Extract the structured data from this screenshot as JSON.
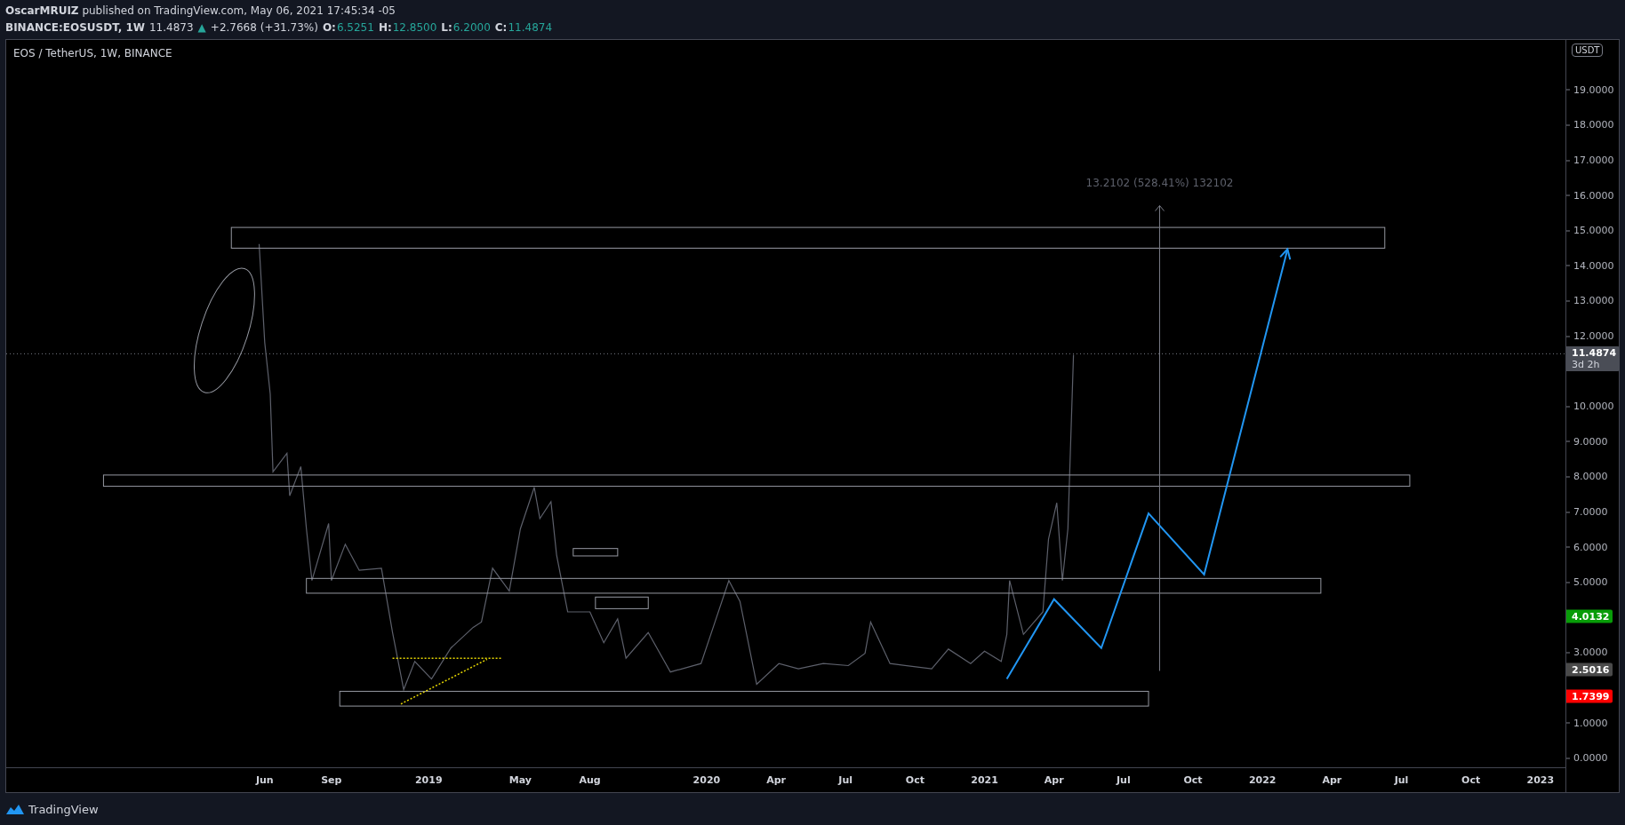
{
  "header": {
    "byline": "**OscarMRUIZ** published on TradingView.com, May 06, 2021 17:45:34 -05",
    "symbol": "BINANCE:EOSUSDT, 1W",
    "last": "11.4873",
    "change_arrow": "▲",
    "change": "+2.7668 (+31.73%)",
    "ohlc": [
      {
        "label": "O:",
        "value": "6.5251"
      },
      {
        "label": "H:",
        "value": "12.8500"
      },
      {
        "label": "L:",
        "value": "6.2000"
      },
      {
        "label": "C:",
        "value": "11.4874"
      }
    ]
  },
  "currency": "USDT",
  "chart_data": {
    "type": "line",
    "title": "EOS / TetherUS, 1W, BINANCE",
    "x": [
      2018.39,
      2018.41,
      2018.43,
      2018.44,
      2018.49,
      2018.5,
      2018.54,
      2018.56,
      2018.58,
      2018.64,
      2018.65,
      2018.7,
      2018.75,
      2018.83,
      2018.87,
      2018.91,
      2018.95,
      2019.01,
      2019.08,
      2019.16,
      2019.19,
      2019.23,
      2019.29,
      2019.33,
      2019.38,
      2019.4,
      2019.44,
      2019.46,
      2019.5,
      2019.58,
      2019.63,
      2019.68,
      2019.71,
      2019.79,
      2019.87,
      2019.98,
      2020.03,
      2020.08,
      2020.12,
      2020.18,
      2020.26,
      2020.33,
      2020.42,
      2020.51,
      2020.57,
      2020.59,
      2020.66,
      2020.81,
      2020.87,
      2020.95,
      2021.0,
      2021.06,
      2021.08,
      2021.09,
      2021.14,
      2021.21,
      2021.23,
      2021.26,
      2021.28,
      2021.3,
      2021.32
    ],
    "series": [
      {
        "color": "#5d606b",
        "values": [
          14.61,
          11.81,
          10.34,
          8.13,
          8.66,
          7.45,
          8.28,
          6.51,
          5.04,
          6.66,
          5.04,
          6.07,
          5.33,
          5.39,
          3.56,
          1.94,
          2.74,
          2.24,
          3.12,
          3.71,
          3.86,
          5.39,
          4.74,
          6.51,
          7.69,
          6.8,
          7.28,
          5.77,
          4.15,
          4.15,
          3.27,
          3.95,
          2.83,
          3.56,
          2.44,
          2.68,
          3.86,
          5.04,
          4.45,
          2.09,
          2.68,
          2.53,
          2.68,
          2.62,
          2.97,
          3.86,
          2.68,
          2.53,
          3.09,
          2.68,
          3.03,
          2.74,
          3.51,
          5.04,
          3.51,
          4.15,
          6.22,
          7.25,
          5.04,
          6.51,
          11.46
        ]
      }
    ],
    "xlim": [
      2017.48,
      2023.09
    ],
    "ylim": [
      -0.27,
      20.41
    ],
    "xticks": [
      {
        "value": 2018.41,
        "label": "Jun"
      },
      {
        "value": 2018.65,
        "label": "Sep"
      },
      {
        "value": 2019,
        "label": "2019"
      },
      {
        "value": 2019.33,
        "label": "May"
      },
      {
        "value": 2019.58,
        "label": "Aug"
      },
      {
        "value": 2020,
        "label": "2020"
      },
      {
        "value": 2020.25,
        "label": "Apr"
      },
      {
        "value": 2020.5,
        "label": "Jul"
      },
      {
        "value": 2020.75,
        "label": "Oct"
      },
      {
        "value": 2021,
        "label": "2021"
      },
      {
        "value": 2021.25,
        "label": "Apr"
      },
      {
        "value": 2021.5,
        "label": "Jul"
      },
      {
        "value": 2021.75,
        "label": "Oct"
      },
      {
        "value": 2022,
        "label": "2022"
      },
      {
        "value": 2022.25,
        "label": "Apr"
      },
      {
        "value": 2022.5,
        "label": "Jul"
      },
      {
        "value": 2022.75,
        "label": "Oct"
      },
      {
        "value": 2023,
        "label": "2023"
      }
    ],
    "yticks": [
      {
        "value": 0,
        "label": "0.0000"
      },
      {
        "value": 1,
        "label": "1.0000"
      },
      {
        "value": 3,
        "label": "3.0000"
      },
      {
        "value": 5,
        "label": "5.0000"
      },
      {
        "value": 6,
        "label": "6.0000"
      },
      {
        "value": 7,
        "label": "7.0000"
      },
      {
        "value": 8,
        "label": "8.0000"
      },
      {
        "value": 9,
        "label": "9.0000"
      },
      {
        "value": 10,
        "label": "10.0000"
      },
      {
        "value": 12,
        "label": "12.0000"
      },
      {
        "value": 13,
        "label": "13.0000"
      },
      {
        "value": 14,
        "label": "14.0000"
      },
      {
        "value": 15,
        "label": "15.0000"
      },
      {
        "value": 16,
        "label": "16.0000"
      },
      {
        "value": 17,
        "label": "17.0000"
      },
      {
        "value": 18,
        "label": "18.0000"
      },
      {
        "value": 19,
        "label": "19.0000"
      }
    ]
  },
  "projection": {
    "color": "#2196f3"
  },
  "measure": {
    "text": "13.2102 (528.41%) 132102"
  },
  "price_labels": [
    {
      "text": "11.4874",
      "sub": "3d 2h",
      "color": "#4a4d56"
    },
    {
      "text": "4.0132",
      "color": "#089c08"
    },
    {
      "text": "2.5016",
      "color": "#4a4a4a"
    },
    {
      "text": "1.7399",
      "color": "#ff0000"
    }
  ],
  "footer": {
    "brand": "TradingView"
  }
}
